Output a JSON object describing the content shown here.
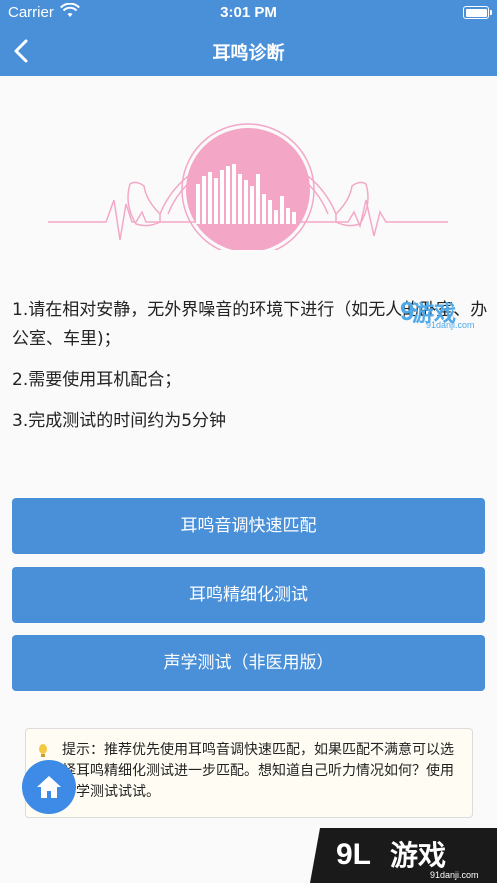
{
  "status_bar": {
    "carrier": "Carrier",
    "time": "3:01 PM",
    "icons": [
      "wifi-icon",
      "battery-icon"
    ]
  },
  "nav": {
    "title": "耳鸣诊断",
    "back_icon": "chevron-left-icon",
    "bar_color": "#4a90d9"
  },
  "hero": {
    "icon": "headphones-sound-wave-illustration",
    "accent_color": "#f06fa8"
  },
  "instructions": [
    "1.请在相对安静，无外界噪音的环境下进行（如无人的卧室、办公室、车里)；",
    "2.需要使用耳机配合；",
    "3.完成测试的时间约为5分钟"
  ],
  "buttons": {
    "quick_match": "耳鸣音调快速匹配",
    "detailed_test": "耳鸣精细化测试",
    "acoustic_test": "声学测试（非医用版）"
  },
  "tip": {
    "icon": "lightbulb-icon",
    "text": "提示：推荐优先使用耳鸣音调快速匹配，如果匹配不满意可以选择耳鸣精细化测试进一步匹配。想知道自己听力情况如何？使用声学测试试试。"
  },
  "home_button": {
    "icon": "home-icon"
  },
  "watermarks": {
    "top_text": "游戏",
    "top_sub": "91danji.com",
    "bottom_text": "游戏",
    "bottom_sub": "91danji.com"
  }
}
